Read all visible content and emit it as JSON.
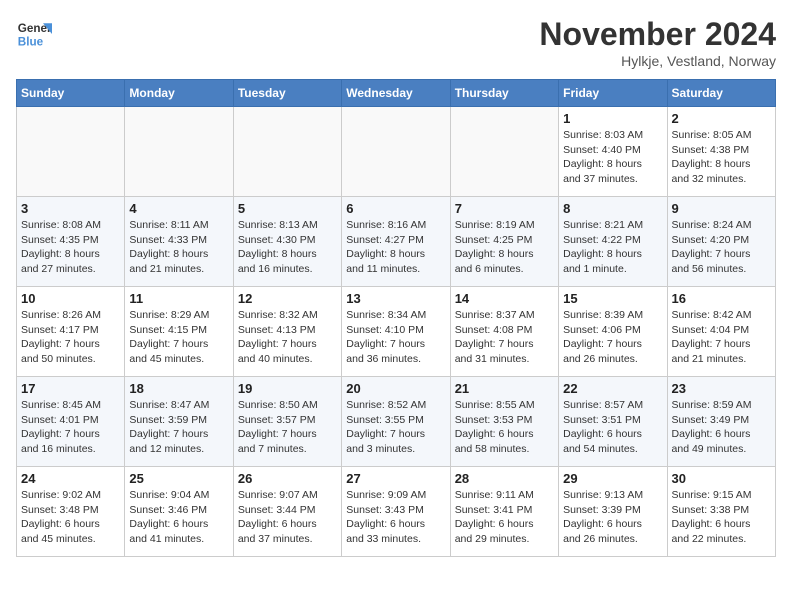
{
  "header": {
    "logo_line1": "General",
    "logo_line2": "Blue",
    "month_title": "November 2024",
    "location": "Hylkje, Vestland, Norway"
  },
  "weekdays": [
    "Sunday",
    "Monday",
    "Tuesday",
    "Wednesday",
    "Thursday",
    "Friday",
    "Saturday"
  ],
  "weeks": [
    [
      {
        "day": "",
        "info": ""
      },
      {
        "day": "",
        "info": ""
      },
      {
        "day": "",
        "info": ""
      },
      {
        "day": "",
        "info": ""
      },
      {
        "day": "",
        "info": ""
      },
      {
        "day": "1",
        "info": "Sunrise: 8:03 AM\nSunset: 4:40 PM\nDaylight: 8 hours\nand 37 minutes."
      },
      {
        "day": "2",
        "info": "Sunrise: 8:05 AM\nSunset: 4:38 PM\nDaylight: 8 hours\nand 32 minutes."
      }
    ],
    [
      {
        "day": "3",
        "info": "Sunrise: 8:08 AM\nSunset: 4:35 PM\nDaylight: 8 hours\nand 27 minutes."
      },
      {
        "day": "4",
        "info": "Sunrise: 8:11 AM\nSunset: 4:33 PM\nDaylight: 8 hours\nand 21 minutes."
      },
      {
        "day": "5",
        "info": "Sunrise: 8:13 AM\nSunset: 4:30 PM\nDaylight: 8 hours\nand 16 minutes."
      },
      {
        "day": "6",
        "info": "Sunrise: 8:16 AM\nSunset: 4:27 PM\nDaylight: 8 hours\nand 11 minutes."
      },
      {
        "day": "7",
        "info": "Sunrise: 8:19 AM\nSunset: 4:25 PM\nDaylight: 8 hours\nand 6 minutes."
      },
      {
        "day": "8",
        "info": "Sunrise: 8:21 AM\nSunset: 4:22 PM\nDaylight: 8 hours\nand 1 minute."
      },
      {
        "day": "9",
        "info": "Sunrise: 8:24 AM\nSunset: 4:20 PM\nDaylight: 7 hours\nand 56 minutes."
      }
    ],
    [
      {
        "day": "10",
        "info": "Sunrise: 8:26 AM\nSunset: 4:17 PM\nDaylight: 7 hours\nand 50 minutes."
      },
      {
        "day": "11",
        "info": "Sunrise: 8:29 AM\nSunset: 4:15 PM\nDaylight: 7 hours\nand 45 minutes."
      },
      {
        "day": "12",
        "info": "Sunrise: 8:32 AM\nSunset: 4:13 PM\nDaylight: 7 hours\nand 40 minutes."
      },
      {
        "day": "13",
        "info": "Sunrise: 8:34 AM\nSunset: 4:10 PM\nDaylight: 7 hours\nand 36 minutes."
      },
      {
        "day": "14",
        "info": "Sunrise: 8:37 AM\nSunset: 4:08 PM\nDaylight: 7 hours\nand 31 minutes."
      },
      {
        "day": "15",
        "info": "Sunrise: 8:39 AM\nSunset: 4:06 PM\nDaylight: 7 hours\nand 26 minutes."
      },
      {
        "day": "16",
        "info": "Sunrise: 8:42 AM\nSunset: 4:04 PM\nDaylight: 7 hours\nand 21 minutes."
      }
    ],
    [
      {
        "day": "17",
        "info": "Sunrise: 8:45 AM\nSunset: 4:01 PM\nDaylight: 7 hours\nand 16 minutes."
      },
      {
        "day": "18",
        "info": "Sunrise: 8:47 AM\nSunset: 3:59 PM\nDaylight: 7 hours\nand 12 minutes."
      },
      {
        "day": "19",
        "info": "Sunrise: 8:50 AM\nSunset: 3:57 PM\nDaylight: 7 hours\nand 7 minutes."
      },
      {
        "day": "20",
        "info": "Sunrise: 8:52 AM\nSunset: 3:55 PM\nDaylight: 7 hours\nand 3 minutes."
      },
      {
        "day": "21",
        "info": "Sunrise: 8:55 AM\nSunset: 3:53 PM\nDaylight: 6 hours\nand 58 minutes."
      },
      {
        "day": "22",
        "info": "Sunrise: 8:57 AM\nSunset: 3:51 PM\nDaylight: 6 hours\nand 54 minutes."
      },
      {
        "day": "23",
        "info": "Sunrise: 8:59 AM\nSunset: 3:49 PM\nDaylight: 6 hours\nand 49 minutes."
      }
    ],
    [
      {
        "day": "24",
        "info": "Sunrise: 9:02 AM\nSunset: 3:48 PM\nDaylight: 6 hours\nand 45 minutes."
      },
      {
        "day": "25",
        "info": "Sunrise: 9:04 AM\nSunset: 3:46 PM\nDaylight: 6 hours\nand 41 minutes."
      },
      {
        "day": "26",
        "info": "Sunrise: 9:07 AM\nSunset: 3:44 PM\nDaylight: 6 hours\nand 37 minutes."
      },
      {
        "day": "27",
        "info": "Sunrise: 9:09 AM\nSunset: 3:43 PM\nDaylight: 6 hours\nand 33 minutes."
      },
      {
        "day": "28",
        "info": "Sunrise: 9:11 AM\nSunset: 3:41 PM\nDaylight: 6 hours\nand 29 minutes."
      },
      {
        "day": "29",
        "info": "Sunrise: 9:13 AM\nSunset: 3:39 PM\nDaylight: 6 hours\nand 26 minutes."
      },
      {
        "day": "30",
        "info": "Sunrise: 9:15 AM\nSunset: 3:38 PM\nDaylight: 6 hours\nand 22 minutes."
      }
    ]
  ]
}
